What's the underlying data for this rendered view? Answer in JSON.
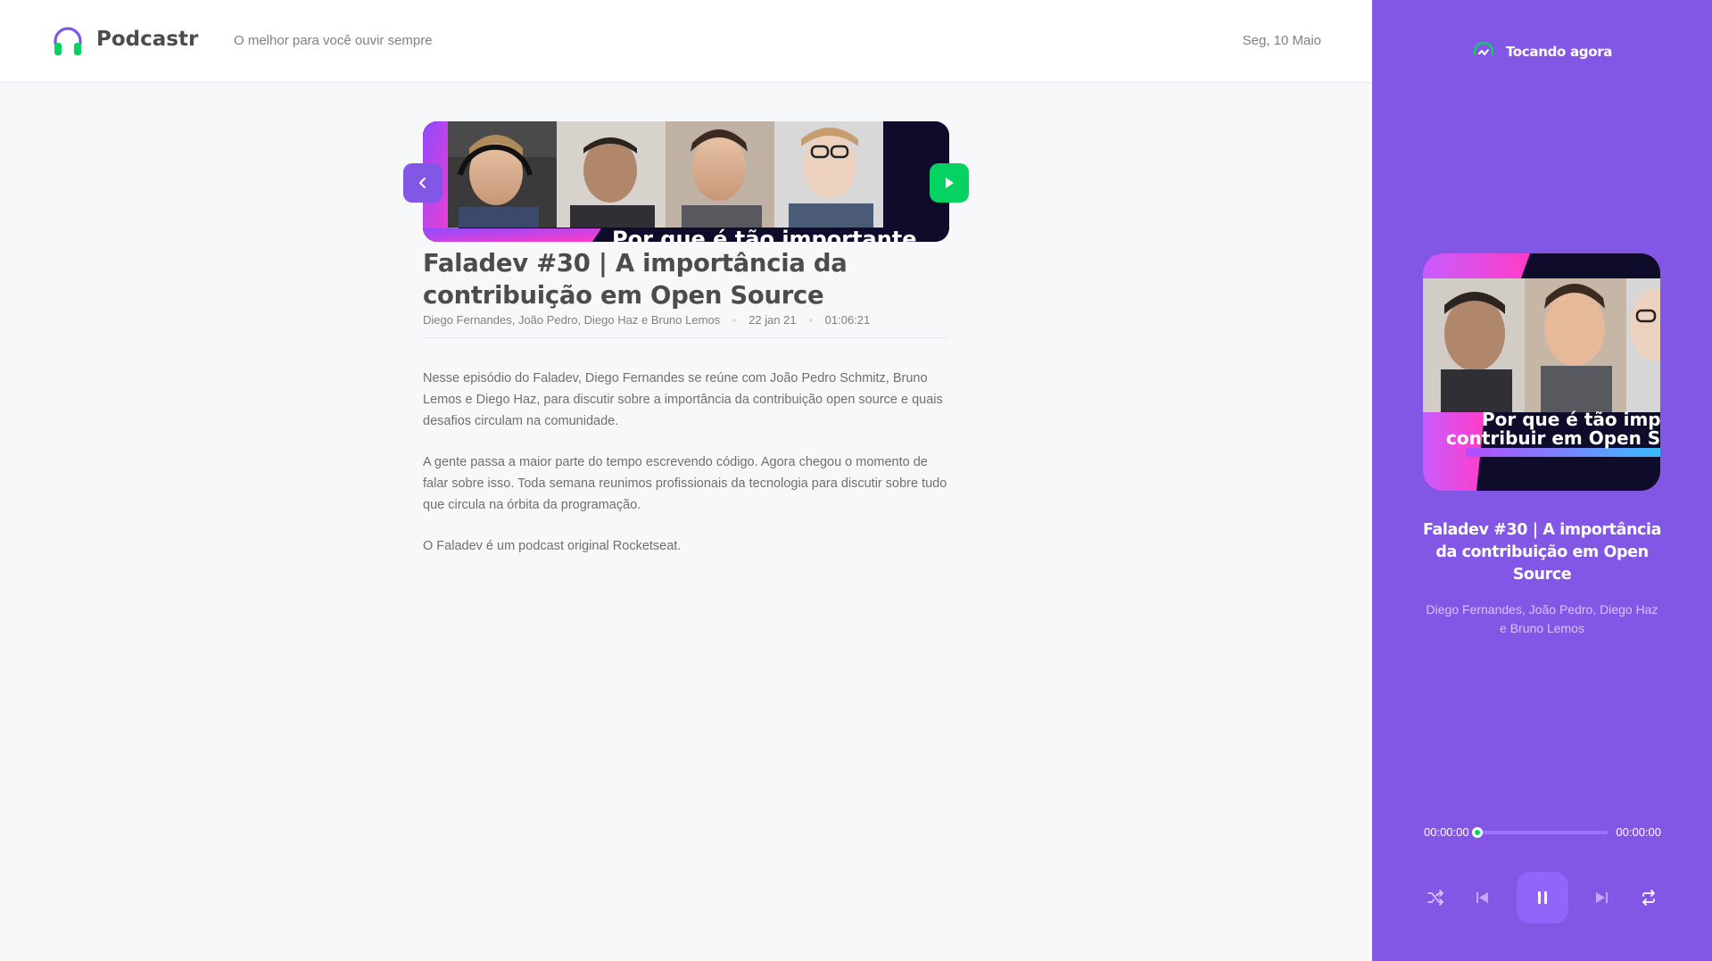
{
  "header": {
    "brand": "Podcastr",
    "tagline": "O melhor para você ouvir sempre",
    "date": "Seg, 10 Maio"
  },
  "episode": {
    "title": "Faladev #30 | A importância da contribuição em Open Source",
    "members": "Diego Fernandes, João Pedro, Diego Haz e Bruno Lemos",
    "published_at": "22 jan 21",
    "duration": "01:06:21",
    "thumbnail_caption": "Por que é tão importante",
    "description": [
      "Nesse episódio do Faladev, Diego Fernandes se reúne com João Pedro Schmitz, Bruno Lemos e Diego Haz, para discutir sobre a importância da contribuição open source e quais desafios circulam na comunidade.",
      "A gente passa a maior parte do tempo escrevendo código. Agora chegou o momento de falar sobre isso. Toda semana reunimos profissionais da tecnologia para discutir sobre tudo que circula na órbita da programação.",
      "O Faladev é um podcast original Rocketseat."
    ],
    "icons": {
      "back": "chevron-left-icon",
      "play": "play-icon"
    }
  },
  "player": {
    "heading": "Tocando agora",
    "title": "Faladev #30 | A importância da contribuição em Open Source",
    "members": "Diego Fernandes, João Pedro, Diego Haz e Bruno Lemos",
    "cover_caption_line1": "Por que é tão imp",
    "cover_caption_line2": "contribuir em Open S",
    "current_time": "00:00:00",
    "total_time": "00:00:00",
    "progress_fraction": 0,
    "state": "playing",
    "controls": [
      "shuffle-icon",
      "previous-icon",
      "pause-icon",
      "next-icon",
      "repeat-icon"
    ]
  },
  "colors": {
    "purple": "#8257e5",
    "purple_light": "#9164fa",
    "green": "#04d361",
    "text_dark": "#494d4b",
    "text_muted": "#808080",
    "background": "#f7f8fa"
  }
}
